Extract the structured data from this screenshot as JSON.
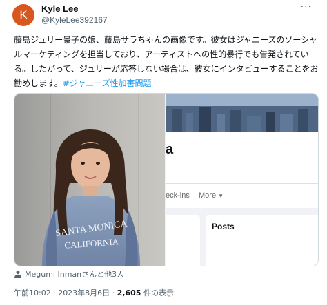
{
  "author": {
    "avatar_letter": "K",
    "avatar_color": "#d9571f",
    "name": "Kyle Lee",
    "handle": "@KyleLee392167"
  },
  "more_menu_icon": "more-horizontal-icon",
  "tweet": {
    "text": "藤島ジュリー景子の娘、藤島サラちゃんの画像です。彼女はジャニーズのソーシャルマーケティングを担当しており、アーティストへの性的暴行でも告発されている。したがって、ジュリーが応答しない場合は、彼女にインタビューすることをお勧めします。",
    "hashtag": "#ジャニーズ性加害問題",
    "hashtag_color": "#1d9bf0"
  },
  "media": {
    "facebook_screenshot": {
      "name_fragment": "a",
      "tab_checkins": "eck-ins",
      "tab_more": "More",
      "posts_title": "Posts"
    }
  },
  "tagged": {
    "icon": "person-icon",
    "text": "Megumi Inmanさんと他3人"
  },
  "meta": {
    "timestamp": "午前10:02 · 2023年8月6日 · ",
    "views_count": "2,605",
    "views_label": " 件の表示"
  }
}
